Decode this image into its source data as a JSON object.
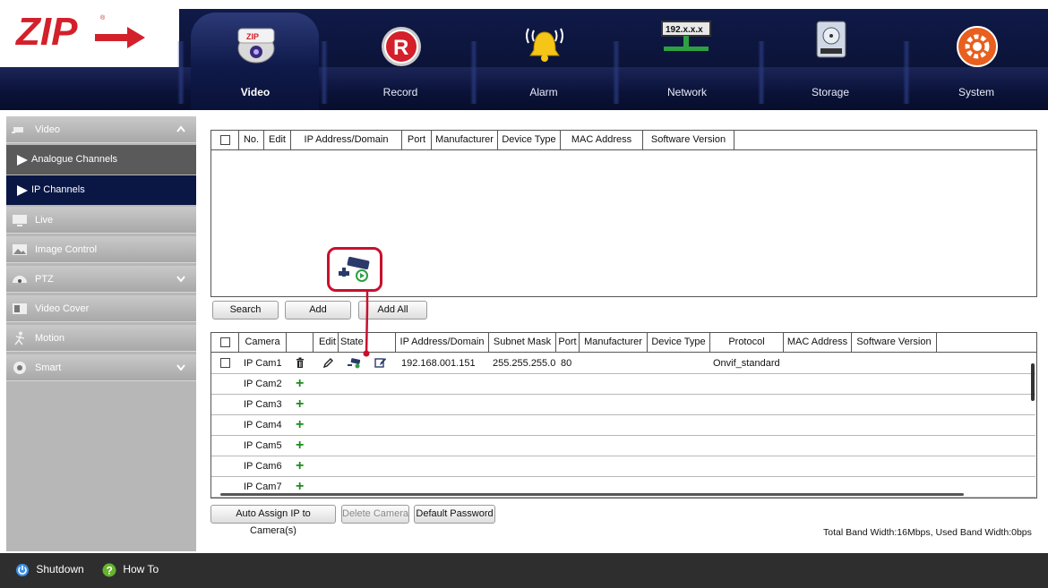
{
  "brand": {
    "logo_text": "ZIP"
  },
  "nav": [
    {
      "label": "Video",
      "icon": "camera-dome-icon",
      "active": true
    },
    {
      "label": "Record",
      "icon": "record-icon"
    },
    {
      "label": "Alarm",
      "icon": "alarm-bell-icon"
    },
    {
      "label": "Network",
      "icon": "network-icon",
      "badge": "192.x.x.x"
    },
    {
      "label": "Storage",
      "icon": "storage-hdd-icon"
    },
    {
      "label": "System",
      "icon": "system-gear-icon"
    }
  ],
  "sidebar": {
    "items": [
      {
        "label": "Video",
        "icon": "camera-icon",
        "expanded": true
      },
      {
        "label": "Analogue Channels",
        "sub": true
      },
      {
        "label": "IP Channels",
        "sub": true,
        "selected": true
      },
      {
        "label": "Live",
        "icon": "monitor-icon"
      },
      {
        "label": "Image Control",
        "icon": "image-icon"
      },
      {
        "label": "PTZ",
        "icon": "ptz-icon"
      },
      {
        "label": "Video Cover",
        "icon": "video-cover-icon"
      },
      {
        "label": "Motion",
        "icon": "motion-icon"
      },
      {
        "label": "Smart",
        "icon": "smart-icon"
      }
    ]
  },
  "search_table": {
    "headers": [
      "No.",
      "Edit",
      "IP Address/Domain",
      "Port",
      "Manufacturer",
      "Device Type",
      "MAC Address",
      "Software Version"
    ]
  },
  "buttons": {
    "search": "Search",
    "add": "Add",
    "add_all": "Add All"
  },
  "camera_table": {
    "headers": [
      "Camera",
      "Edit",
      "State",
      "IP Address/Domain",
      "Subnet Mask",
      "Port",
      "Manufacturer",
      "Device Type",
      "Protocol",
      "MAC Address",
      "Software Version"
    ],
    "rows": [
      {
        "camera": "IP Cam1",
        "ip": "192.168.001.151",
        "mask": "255.255.255.0",
        "port": "80",
        "protocol": "Onvif_standard"
      },
      {
        "camera": "IP Cam2"
      },
      {
        "camera": "IP Cam3"
      },
      {
        "camera": "IP Cam4"
      },
      {
        "camera": "IP Cam5"
      },
      {
        "camera": "IP Cam6"
      },
      {
        "camera": "IP Cam7"
      }
    ]
  },
  "bottom_buttons": {
    "auto_assign": "Auto Assign IP to Camera(s)",
    "delete_camera": "Delete Camera",
    "default_password": "Default Password"
  },
  "bandwidth_text": "Total Band Width:16Mbps, Used Band Width:0bps",
  "footer": {
    "shutdown": "Shutdown",
    "howto": "How To"
  },
  "colors": {
    "nav_bg": "#0a1238",
    "accent_red": "#d3202a",
    "sidebar_selected": "#0a1745",
    "plus_green": "#1e8a1e"
  }
}
